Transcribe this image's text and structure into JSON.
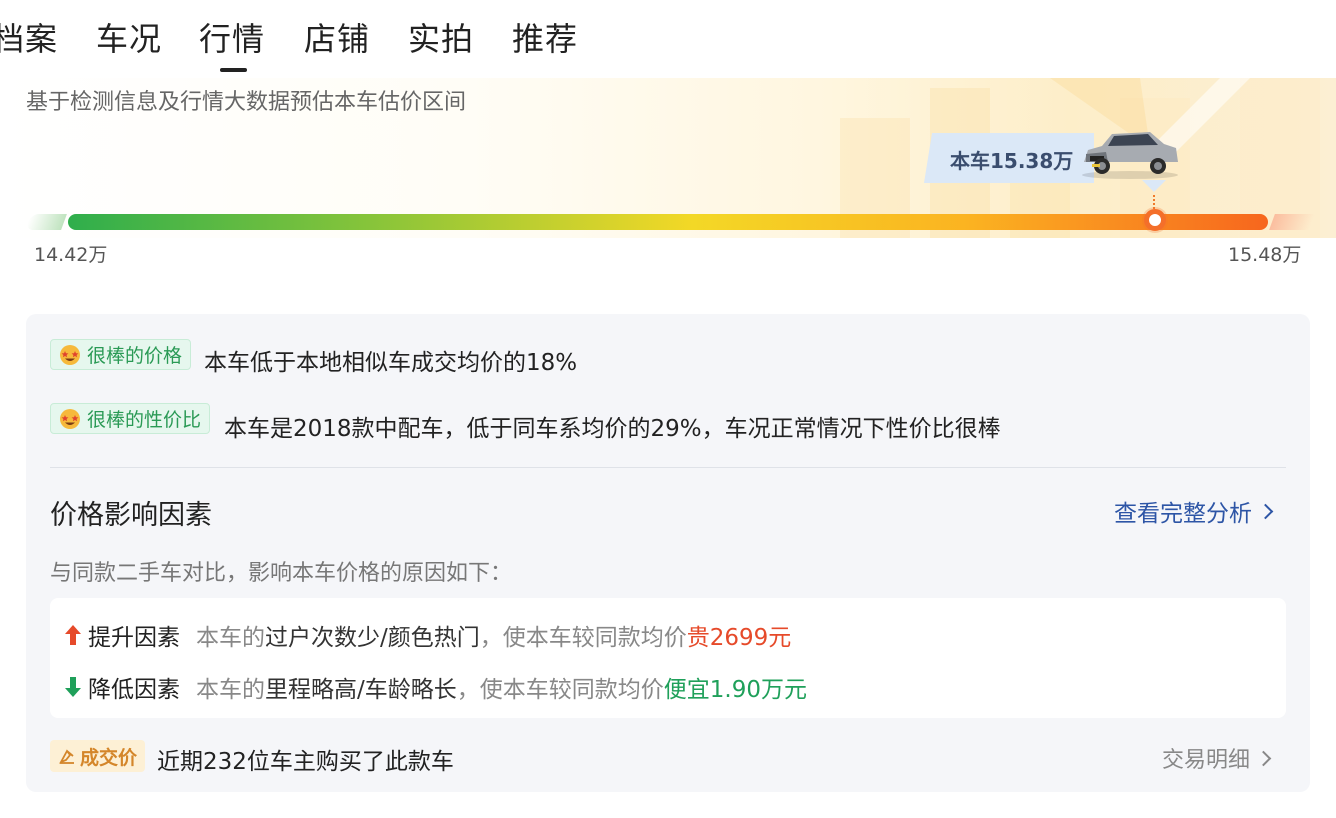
{
  "tabs": [
    {
      "label": "档案"
    },
    {
      "label": "车况"
    },
    {
      "label": "行情",
      "active": true
    },
    {
      "label": "店铺"
    },
    {
      "label": "实拍"
    },
    {
      "label": "推荐"
    }
  ],
  "estimate": {
    "subtitle": "基于检测信息及行情大数据预估本车估价区间",
    "car_price_label": "本车15.38万",
    "range_min": "14.42万",
    "range_max": "15.48万",
    "marker_position_pct": 90.6
  },
  "ratings": [
    {
      "badge": "很棒的价格",
      "text": "本车低于本地相似车成交均价的18%",
      "icon": "star-eyes-emoji-icon"
    },
    {
      "badge": "很棒的性价比",
      "text": "本车是2018款中配车，低于同车系均价的29%，车况正常情况下性价比很棒",
      "icon": "star-eyes-emoji-icon"
    }
  ],
  "factors_section": {
    "title": "价格影响因素",
    "link": "查看完整分析",
    "hint": "与同款二手车对比，影响本车价格的原因如下：",
    "increase": {
      "name": "提升因素",
      "prefix": "本车的",
      "key": "过户次数少/颜色热门",
      "middle": "，使本车较同款均价",
      "effect": "贵2699元"
    },
    "decrease": {
      "name": "降低因素",
      "prefix": "本车的",
      "key": "里程略高/车龄略长",
      "middle": "，使本车较同款均价",
      "effect": "便宜1.90万元"
    }
  },
  "deal": {
    "badge": "成交价",
    "text": "近期232位车主购买了此款车",
    "link": "交易明细"
  },
  "colors": {
    "accent_blue": "#2d55a6",
    "up_red": "#e64a2a",
    "down_green": "#1fa05a",
    "badge_green": "#2a9a55",
    "deal_orange": "#d4862a"
  }
}
